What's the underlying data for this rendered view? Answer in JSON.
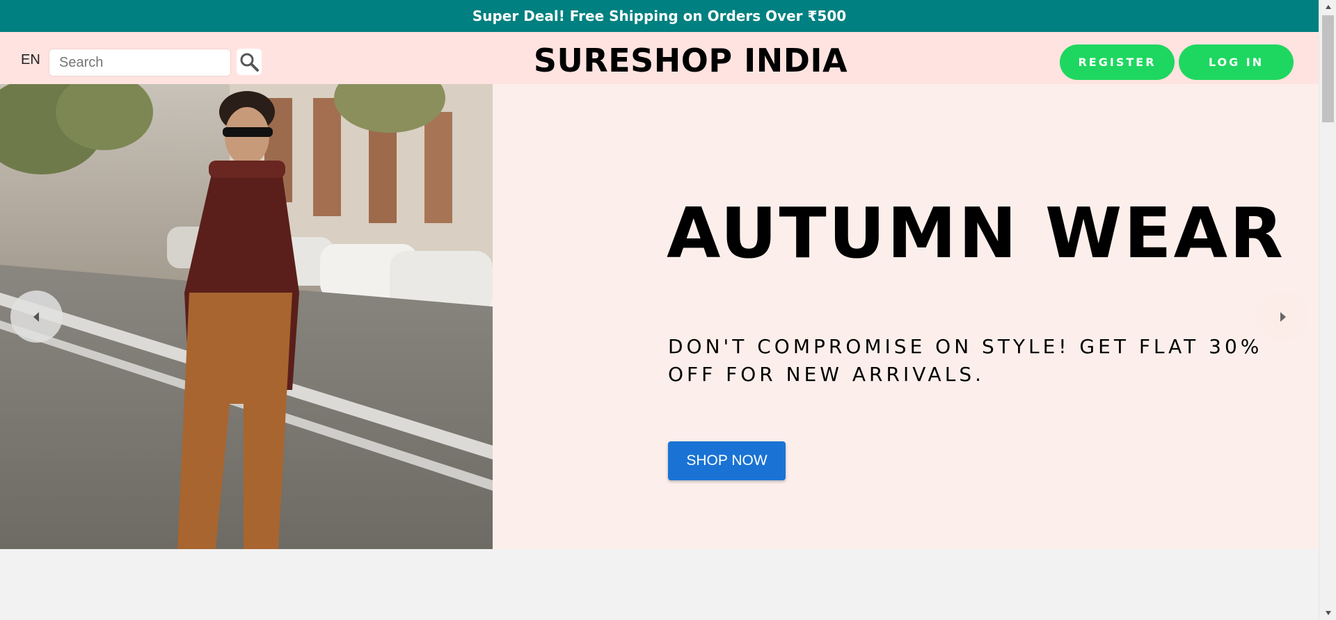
{
  "announcement": {
    "text": "Super Deal! Free Shipping on Orders Over ₹500"
  },
  "header": {
    "language": "EN",
    "search": {
      "placeholder": "Search",
      "value": ""
    },
    "search_icon": "magnifier-icon",
    "brand": "SURESHOP INDIA",
    "register_label": "REGISTER",
    "login_label": "LOG IN"
  },
  "hero": {
    "title": "AUTUMN WEAR",
    "description": "DON'T COMPROMISE ON STYLE! GET FLAT 30% OFF FOR NEW ARRIVALS.",
    "cta_label": "SHOP NOW",
    "prev_icon": "caret-left-icon",
    "next_icon": "caret-right-icon"
  },
  "colors": {
    "announcement_bg": "#008080",
    "navbar_bg": "#ffe3e0",
    "hero_bg": "#fcefeb",
    "auth_button": "#1ed760",
    "cta_button": "#1a73d4"
  }
}
